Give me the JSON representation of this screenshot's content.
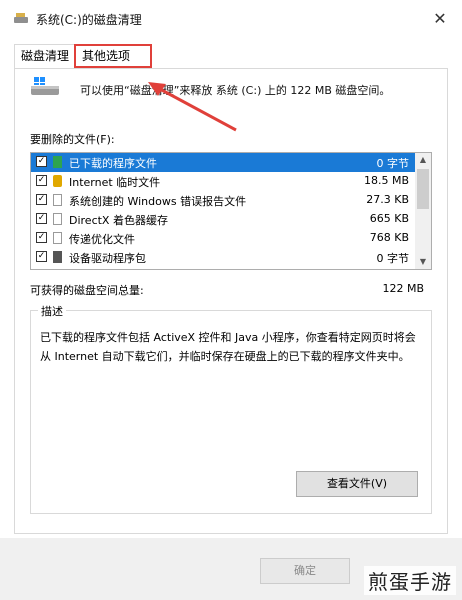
{
  "window": {
    "title": "系统(C:)的磁盘清理",
    "close_glyph": "✕"
  },
  "tabs": [
    {
      "label": "磁盘清理"
    },
    {
      "label": "其他选项"
    }
  ],
  "intro": "可以使用“磁盘清理”来释放 系统 (C:) 上的 122 MB 磁盘空间。",
  "files_label": "要删除的文件(F):",
  "files": [
    {
      "name": "已下载的程序文件",
      "size": "0 字节",
      "checked": true,
      "icon": "green-file-icon"
    },
    {
      "name": "Internet 临时文件",
      "size": "18.5 MB",
      "checked": true,
      "icon": "lock-icon"
    },
    {
      "name": "系统创建的 Windows 错误报告文件",
      "size": "27.3 KB",
      "checked": true,
      "icon": "document-icon"
    },
    {
      "name": "DirectX 着色器缓存",
      "size": "665 KB",
      "checked": true,
      "icon": "document-icon"
    },
    {
      "name": "传递优化文件",
      "size": "768 KB",
      "checked": true,
      "icon": "document-icon"
    },
    {
      "name": "设备驱动程序包",
      "size": "0 字节",
      "checked": true,
      "icon": "driver-package-icon"
    }
  ],
  "checkbox_glyph": "✓",
  "scroll": {
    "up": "▲",
    "down": "▼"
  },
  "total": {
    "label": "可获得的磁盘空间总量:",
    "value": "122 MB"
  },
  "description": {
    "legend": "描述",
    "text": "已下载的程序文件包括 ActiveX 控件和 Java 小程序，你查看特定网页时将会从 Internet 自动下载它们，并临时保存在硬盘上的已下载的程序文件夹中。"
  },
  "view_files_button": "查看文件(V)",
  "ok_button": "确定",
  "watermark": "煎蛋手游",
  "colors": {
    "selection": "#1a7ad6",
    "highlight_border": "#e0403a"
  }
}
